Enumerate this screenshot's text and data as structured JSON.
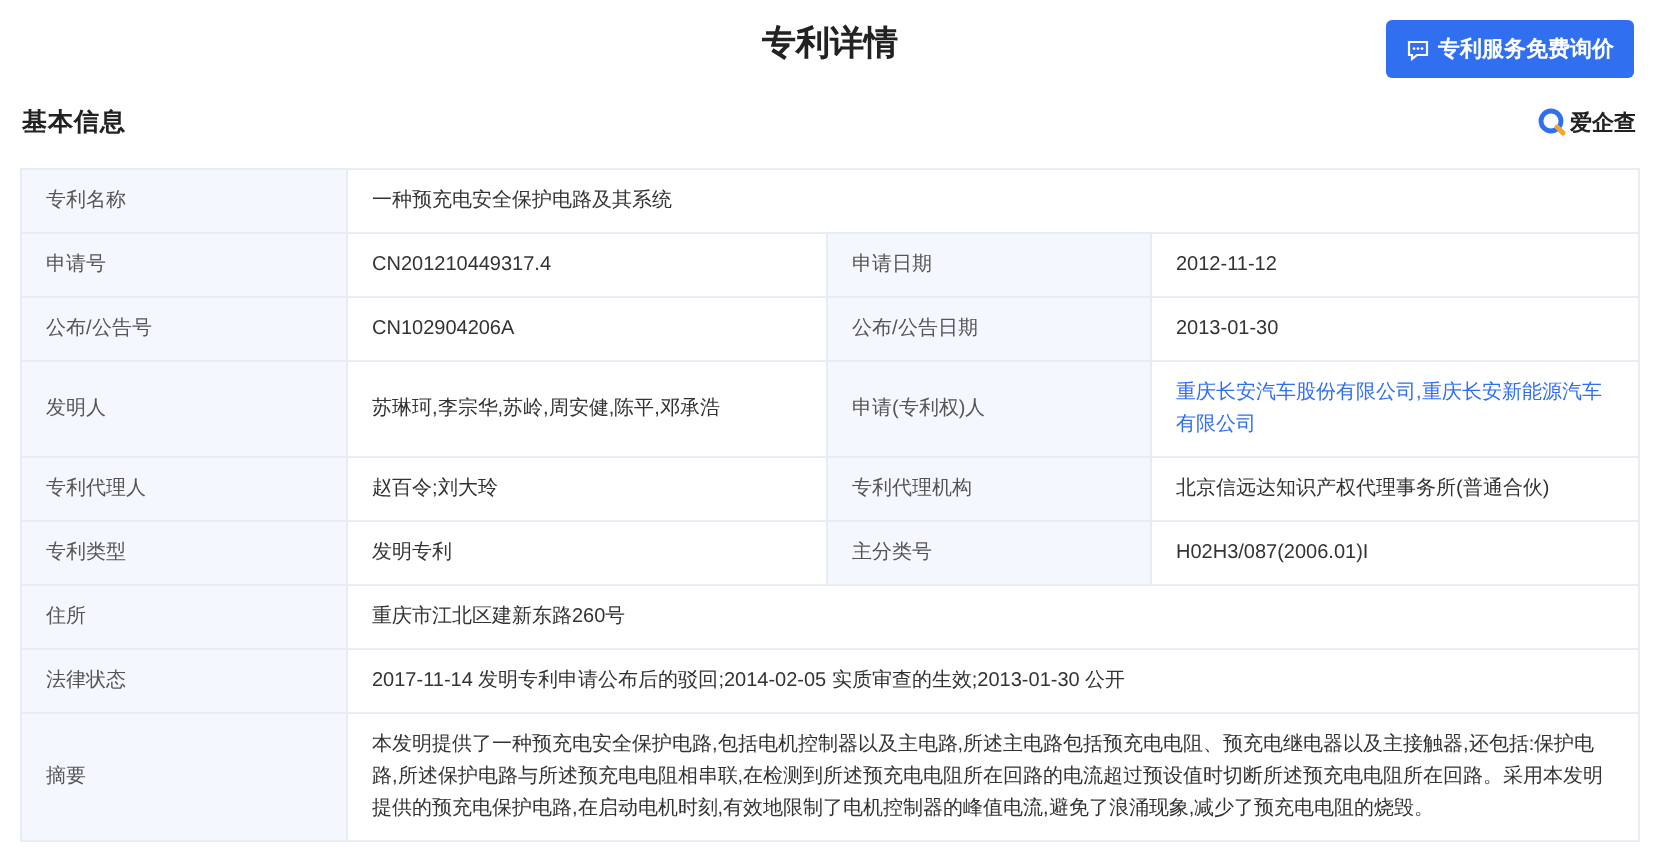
{
  "title": "专利详情",
  "quote_button": {
    "label": "专利服务免费询价"
  },
  "section": {
    "title": "基本信息",
    "brand": "爱企查"
  },
  "rows": [
    {
      "kind": "full",
      "cells": [
        {
          "label": "专利名称",
          "value": "一种预充电安全保护电路及其系统"
        }
      ]
    },
    {
      "kind": "pair",
      "cells": [
        {
          "label": "申请号",
          "value": "CN201210449317.4"
        },
        {
          "label": "申请日期",
          "value": "2012-11-12"
        }
      ]
    },
    {
      "kind": "pair",
      "cells": [
        {
          "label": "公布/公告号",
          "value": "CN102904206A"
        },
        {
          "label": "公布/公告日期",
          "value": "2013-01-30"
        }
      ]
    },
    {
      "kind": "pair",
      "cells": [
        {
          "label": "发明人",
          "value": "苏琳珂,李宗华,苏岭,周安健,陈平,邓承浩"
        },
        {
          "label": "申请(专利权)人",
          "value": "重庆长安汽车股份有限公司,重庆长安新能源汽车有限公司",
          "link": true
        }
      ]
    },
    {
      "kind": "pair",
      "cells": [
        {
          "label": "专利代理人",
          "value": "赵百令;刘大玲"
        },
        {
          "label": "专利代理机构",
          "value": "北京信远达知识产权代理事务所(普通合伙)"
        }
      ]
    },
    {
      "kind": "pair",
      "cells": [
        {
          "label": "专利类型",
          "value": "发明专利"
        },
        {
          "label": "主分类号",
          "value": "H02H3/087(2006.01)I"
        }
      ]
    },
    {
      "kind": "full",
      "cells": [
        {
          "label": "住所",
          "value": "重庆市江北区建新东路260号"
        }
      ]
    },
    {
      "kind": "full",
      "cells": [
        {
          "label": "法律状态",
          "value": "2017-11-14 发明专利申请公布后的驳回;2014-02-05 实质审查的生效;2013-01-30 公开"
        }
      ]
    },
    {
      "kind": "full",
      "cells": [
        {
          "label": "摘要",
          "value": "本发明提供了一种预充电安全保护电路,包括电机控制器以及主电路,所述主电路包括预充电电阻、预充电继电器以及主接触器,还包括:保护电路,所述保护电路与所述预充电电阻相串联,在检测到所述预充电电阻所在回路的电流超过预设值时切断所述预充电电阻所在回路。采用本发明提供的预充电保护电路,在启动电机时刻,有效地限制了电机控制器的峰值电流,避免了浪涌现象,减少了预充电电阻的烧毁。"
        }
      ]
    }
  ]
}
